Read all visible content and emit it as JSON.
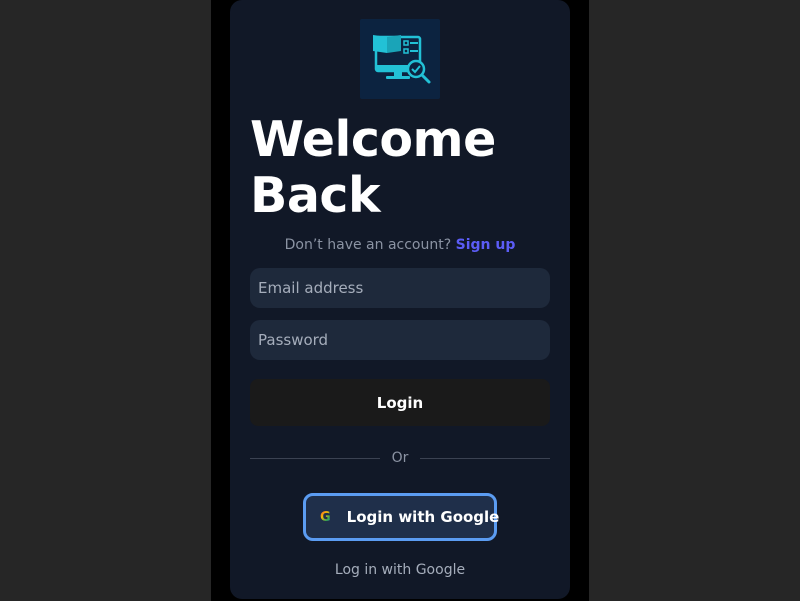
{
  "page": {
    "heading": "Welcome Back",
    "signup_prompt": "Don’t have an account?",
    "signup_link": "Sign up"
  },
  "form": {
    "email_placeholder": "Email address",
    "email_value": "",
    "password_placeholder": "Password",
    "password_value": "",
    "login_label": "Login"
  },
  "divider": {
    "label": "Or"
  },
  "google": {
    "icon_glyph": "G",
    "icon_name": "google-icon",
    "button_label": "Login with Google",
    "footer_link": "Log in with Google"
  },
  "logo": {
    "icon_name": "book-monitor-check-icon"
  },
  "colors": {
    "background": "#262626",
    "card": "#111827",
    "input": "#1e293b",
    "accent_link": "#5b5cf5",
    "login_button": "#1a1a1a",
    "google_border": "#5b9cf2",
    "logo_teal": "#22c1d6"
  }
}
